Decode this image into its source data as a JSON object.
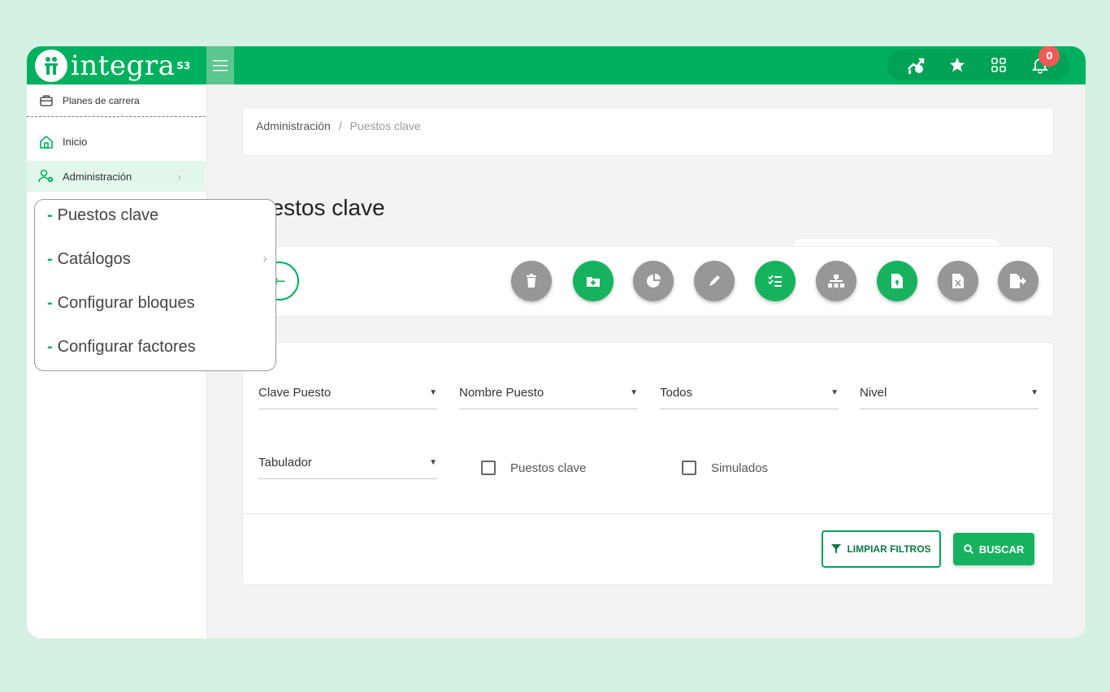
{
  "app": {
    "logo_text": "integra",
    "logo_sup": "S3"
  },
  "topbar": {
    "notification_count": "0"
  },
  "sidebar": {
    "items": [
      {
        "label": "Planes de carrera",
        "icon": "briefcase-icon"
      },
      {
        "label": "Inicio",
        "icon": "home-icon"
      },
      {
        "label": "Administración",
        "icon": "users-gear-icon"
      }
    ]
  },
  "submenu": {
    "items": [
      {
        "label": "Puestos clave"
      },
      {
        "label": "Catálogos"
      },
      {
        "label": "Configurar bloques"
      },
      {
        "label": "Configurar factores"
      }
    ]
  },
  "breadcrumb": {
    "parent": "Administración",
    "separator": "/",
    "current": "Puestos clave"
  },
  "page": {
    "title": "uestos clave"
  },
  "filters": {
    "selects": [
      {
        "label": "Clave Puesto"
      },
      {
        "label": "Nombre Puesto"
      },
      {
        "label": "Todos"
      },
      {
        "label": "Nivel"
      },
      {
        "label": "Tabulador"
      }
    ],
    "checkboxes": [
      {
        "label": "Puestos clave",
        "checked": false
      },
      {
        "label": "Simulados",
        "checked": false
      }
    ],
    "clear_label": "LIMPIAR FILTROS",
    "search_label": "BUSCAR"
  },
  "colors": {
    "primary": "#00b05e",
    "background": "#d5f1e1",
    "badge": "#f25a5a",
    "disabled": "#979797"
  }
}
